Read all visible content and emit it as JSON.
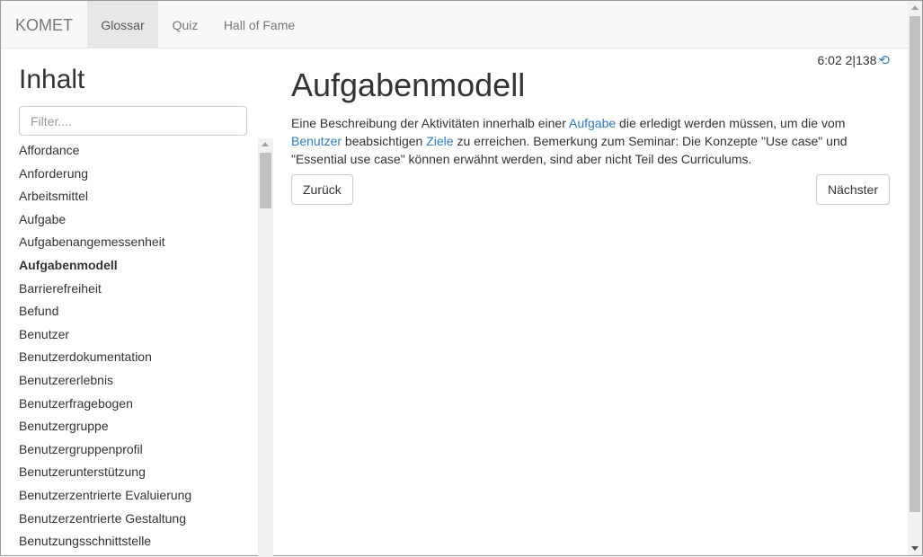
{
  "navbar": {
    "brand": "KOMET",
    "items": [
      {
        "label": "Glossar",
        "active": true
      },
      {
        "label": "Quiz",
        "active": false
      },
      {
        "label": "Hall of Fame",
        "active": false
      }
    ]
  },
  "status": {
    "time": "6:02",
    "progress": "2|138",
    "reload_icon": "history-icon"
  },
  "sidebar": {
    "title": "Inhalt",
    "filter_placeholder": "Filter....",
    "items": [
      "Affordance",
      "Anforderung",
      "Arbeitsmittel",
      "Aufgabe",
      "Aufgabenangemessenheit",
      "Aufgabenmodell",
      "Barrierefreiheit",
      "Befund",
      "Benutzer",
      "Benutzerdokumentation",
      "Benutzererlebnis",
      "Benutzerfragebogen",
      "Benutzergruppe",
      "Benutzergruppenprofil",
      "Benutzerunterstützung",
      "Benutzerzentrierte Evaluierung",
      "Benutzerzentrierte Gestaltung",
      "Benutzungsschnittstelle"
    ],
    "current_index": 5
  },
  "main": {
    "title": "Aufgabenmodell",
    "description": {
      "t1": "Eine Beschreibung der Aktivitäten innerhalb einer ",
      "link1": "Aufgabe",
      "t2": " die erledigt werden müssen, um die vom ",
      "link2": "Benutzer",
      "t3": " beabsichtigen ",
      "link3": "Ziele",
      "t4": " zu erreichen. Bemerkung zum Seminar: Die Konzepte \"Use case\" und \"Essential use case\" können erwähnt werden, sind aber nicht Teil des Curriculums."
    },
    "prev_label": "Zurück",
    "next_label": "Nächster"
  },
  "colors": {
    "link": "#337ab7",
    "navbar_bg": "#f8f8f8",
    "nav_active_bg": "#e7e7e7"
  }
}
